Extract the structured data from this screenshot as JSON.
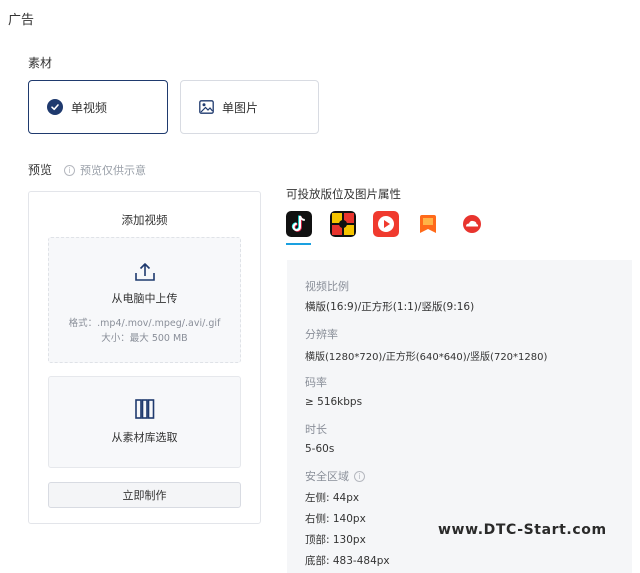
{
  "header": {
    "title": "广告"
  },
  "material": {
    "section_title": "素材",
    "options": [
      {
        "label": "单视频",
        "selected": true
      },
      {
        "label": "单图片",
        "selected": false
      }
    ]
  },
  "preview": {
    "title": "预览",
    "hint": "预览仅供示意",
    "panel_title": "添加视频",
    "upload": {
      "label": "从电脑中上传",
      "formats": "格式：.mp4/.mov/.mpeg/.avi/.gif",
      "size": "大小：最大 500 MB"
    },
    "library_label": "从素材库选取",
    "make_button": "立即制作"
  },
  "placement": {
    "title": "可投放版位及图片属性",
    "platforms": [
      {
        "icon": "douyin-icon",
        "color": "#111111"
      },
      {
        "icon": "xigua-icon",
        "color": "#f5c400"
      },
      {
        "icon": "huoshan-icon",
        "color": "#f03a2e"
      },
      {
        "icon": "fanqie-novel-icon",
        "color": "#ff6a1a"
      },
      {
        "icon": "cloud-icon",
        "color": "#e8342e"
      }
    ],
    "specs": {
      "ratio_label": "视频比例",
      "ratio_value": "横版(16:9)/正方形(1:1)/竖版(9:16)",
      "resolution_label": "分辨率",
      "resolution_value": "横版(1280*720)/正方形(640*640)/竖版(720*1280)",
      "bitrate_label": "码率",
      "bitrate_value": "≥ 516kbps",
      "duration_label": "时长",
      "duration_value": "5-60s",
      "safe_area_label": "安全区域",
      "left": "左侧: 44px",
      "right": "右侧: 140px",
      "top": "顶部: 130px",
      "bottom": "底部: 483-484px"
    }
  },
  "watermark": "www.DTC-Start.com",
  "colors": {
    "accent": "#1f3a6e",
    "tab_underline": "#1aa0e0"
  }
}
